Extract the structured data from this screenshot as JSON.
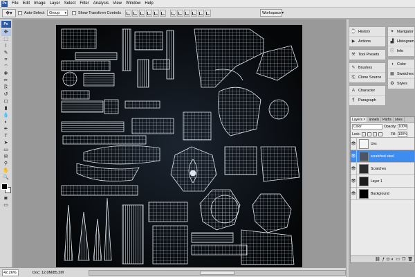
{
  "menus": [
    "File",
    "Edit",
    "Image",
    "Layer",
    "Select",
    "Filter",
    "Analysis",
    "View",
    "Window",
    "Help"
  ],
  "options": {
    "auto_select_label": "Auto-Select:",
    "auto_select_value": "Group",
    "show_transform_label": "Show Transform Controls",
    "workspace_label": "Workspace"
  },
  "tools": [
    "move-tool",
    "marquee-tool",
    "lasso-tool",
    "quick-select-tool",
    "crop-tool",
    "slice-tool",
    "healing-tool",
    "brush-tool",
    "clone-stamp-tool",
    "history-brush-tool",
    "eraser-tool",
    "gradient-tool",
    "blur-tool",
    "dodge-tool",
    "pen-tool",
    "type-tool",
    "path-select-tool",
    "shape-tool",
    "notes-tool",
    "eyedropper-tool",
    "hand-tool",
    "zoom-tool"
  ],
  "tool_glyphs": [
    "✥",
    "⬚",
    "⌇",
    "✎",
    "⌗",
    "⌔",
    "✚",
    "✏",
    "⎘",
    "↺",
    "◻",
    "▮",
    "💧",
    "◐",
    "✒",
    "T",
    "➤",
    "▭",
    "✉",
    "⚲",
    "✋",
    "🔍"
  ],
  "panels_col1": [
    [
      {
        "label": "History",
        "icon": "history-icon",
        "glyph": "⌚"
      },
      {
        "label": "Actions",
        "icon": "actions-icon",
        "glyph": "▶"
      }
    ],
    [
      {
        "label": "Tool Presets",
        "icon": "tool-presets-icon",
        "glyph": "⚒"
      }
    ],
    [
      {
        "label": "Brushes",
        "icon": "brushes-icon",
        "glyph": "✎"
      },
      {
        "label": "Clone Source",
        "icon": "clone-source-icon",
        "glyph": "⎘"
      }
    ],
    [
      {
        "label": "Character",
        "icon": "character-icon",
        "glyph": "A"
      },
      {
        "label": "Paragraph",
        "icon": "paragraph-icon",
        "glyph": "¶"
      }
    ]
  ],
  "panels_col2": [
    [
      {
        "label": "Navigator",
        "icon": "navigator-icon",
        "glyph": "✦"
      },
      {
        "label": "Histogram",
        "icon": "histogram-icon",
        "glyph": "▟"
      },
      {
        "label": "Info",
        "icon": "info-icon",
        "glyph": "ⓘ"
      }
    ],
    [
      {
        "label": "Color",
        "icon": "color-icon",
        "glyph": "◑"
      },
      {
        "label": "Swatches",
        "icon": "swatches-icon",
        "glyph": "▦"
      },
      {
        "label": "Styles",
        "icon": "styles-icon",
        "glyph": "✪"
      }
    ]
  ],
  "layers_panel": {
    "tabs": [
      "Layers ×",
      "annels",
      "Paths",
      "ories"
    ],
    "blend_mode": "Color",
    "opacity_label": "Opacity:",
    "opacity_value": "100%",
    "lock_label": "Lock:",
    "fill_label": "Fill:",
    "fill_value": "100%",
    "layers": [
      {
        "name": "Uvs",
        "selected": false,
        "thumb": "#f4f4f4"
      },
      {
        "name": "scratched steel",
        "selected": true,
        "thumb": "#4a5666"
      },
      {
        "name": "Scratches",
        "selected": false,
        "thumb": "#2c2c2c"
      },
      {
        "name": "Layer 1",
        "selected": false,
        "thumb": "#1c1c1c"
      },
      {
        "name": "Background",
        "selected": false,
        "thumb": "#000000"
      }
    ]
  },
  "status": {
    "zoom": "42.26%",
    "doc": "Doc: 12.0M/85.2M"
  }
}
